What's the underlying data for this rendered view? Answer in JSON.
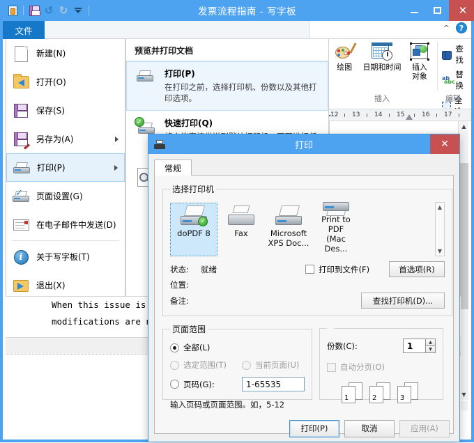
{
  "window": {
    "title": "发票流程指南 - 写字板",
    "quick_access": [
      "app-icon",
      "save-icon",
      "undo-icon",
      "redo-icon",
      "customize-dropdown-icon"
    ],
    "controls": {
      "minimize": "–",
      "maximize": "□",
      "close": "✕"
    }
  },
  "ribbon": {
    "file_tab": "文件",
    "collapse": "^",
    "help": "?",
    "insert_group": {
      "label": "插入",
      "items": [
        {
          "label": "绘图",
          "icon": "paint-palette-icon"
        },
        {
          "label": "日期和时间",
          "icon": "calendar-clock-icon"
        },
        {
          "label": "插入\n对象",
          "line1": "插入",
          "line2": "对象",
          "icon": "insert-object-icon"
        }
      ]
    },
    "edit_group": {
      "label": "编辑",
      "items": [
        {
          "label": "查找",
          "icon": "binoculars-icon"
        },
        {
          "label": "替换",
          "icon": "replace-icon"
        },
        {
          "label": "全选",
          "icon": "select-all-icon"
        }
      ]
    }
  },
  "ruler": {
    "numbers": [
      "12",
      "13",
      "14",
      "15",
      "16",
      "17"
    ],
    "marker_position": "15"
  },
  "file_menu": {
    "items": [
      {
        "label": "新建(N)",
        "icon": "new-document-icon",
        "submenu": false,
        "selected": false
      },
      {
        "label": "打开(O)",
        "icon": "open-folder-icon",
        "submenu": false,
        "selected": false
      },
      {
        "label": "保存(S)",
        "icon": "save-floppy-icon",
        "submenu": false,
        "selected": false
      },
      {
        "label": "另存为(A)",
        "icon": "save-as-icon",
        "submenu": true,
        "selected": false
      },
      {
        "label": "打印(P)",
        "icon": "printer-icon",
        "submenu": true,
        "selected": true
      },
      {
        "label": "页面设置(G)",
        "icon": "page-setup-icon",
        "submenu": false,
        "selected": false
      },
      {
        "label": "在电子邮件中发送(D)",
        "icon": "mail-icon",
        "submenu": false,
        "selected": false
      },
      {
        "label": "关于写字板(T)",
        "icon": "about-info-icon",
        "submenu": false,
        "selected": false
      },
      {
        "label": "退出(X)",
        "icon": "exit-icon",
        "submenu": false,
        "selected": false
      }
    ]
  },
  "backstage": {
    "title": "预览并打印文档",
    "items": [
      {
        "head": "打印(P)",
        "desc": "在打印之前，选择打印机、份数以及其他打印选项。",
        "icon": "printer-icon",
        "highlighted": true
      },
      {
        "head": "快速打印(Q)",
        "desc": "将文档直接发送到默认打印机，而不进行任何更改。",
        "icon": "quick-print-icon",
        "highlighted": false
      },
      {
        "head": "",
        "desc": "",
        "icon": "print-preview-icon",
        "highlighted": false
      }
    ]
  },
  "document": {
    "line1": "When this issue is re",
    "line2": "modifications are ne"
  },
  "print_dialog": {
    "title": "打印",
    "close": "✕",
    "tabs": [
      {
        "label": "常规",
        "active": true
      }
    ],
    "printer_group": {
      "legend": "选择打印机",
      "printers": [
        {
          "name": "doPDF 8",
          "name_line2": "",
          "selected": true,
          "is_default": true,
          "type": "printer"
        },
        {
          "name": "Fax",
          "name_line2": "",
          "selected": false,
          "is_default": false,
          "type": "fax"
        },
        {
          "name": "Microsoft",
          "name_line2": "XPS Doc...",
          "selected": false,
          "is_default": false,
          "type": "printer"
        },
        {
          "name": "Print to PDF",
          "name_line2": "(Mac Des...",
          "selected": false,
          "is_default": false,
          "type": "printer"
        }
      ],
      "status_label": "状态:",
      "status_value": "就绪",
      "location_label": "位置:",
      "location_value": "",
      "comment_label": "备注:",
      "comment_value": "",
      "print_to_file": {
        "label": "打印到文件(F)",
        "checked": false
      },
      "preferences_button": "首选项(R)",
      "find_printer_button": "查找打印机(D)..."
    },
    "page_range": {
      "legend": "页面范围",
      "all": {
        "label": "全部(L)",
        "selected": true,
        "enabled": true
      },
      "selection": {
        "label": "选定范围(T)",
        "selected": false,
        "enabled": false
      },
      "current_page": {
        "label": "当前页面(U)",
        "selected": false,
        "enabled": false
      },
      "pages": {
        "label": "页码(G):",
        "selected": false,
        "enabled": true,
        "value": "1-65535"
      },
      "hint": "输入页码或页面范围。如，5-12"
    },
    "copies": {
      "label": "份数(C):",
      "value": "1",
      "collate": {
        "label": "自动分页(O)",
        "checked": false,
        "enabled": false
      },
      "collate_preview": [
        {
          "front": "1",
          "back": "1"
        },
        {
          "front": "2",
          "back": "2"
        },
        {
          "front": "3",
          "back": "3"
        }
      ]
    },
    "buttons": {
      "print": "打印(P)",
      "cancel": "取消",
      "apply": "应用(A)"
    }
  },
  "colors": {
    "title_blue": "#4ea3f0",
    "file_tab_blue": "#1578c8",
    "close_red": "#c75050",
    "selection_blue": "#cde8fa"
  }
}
